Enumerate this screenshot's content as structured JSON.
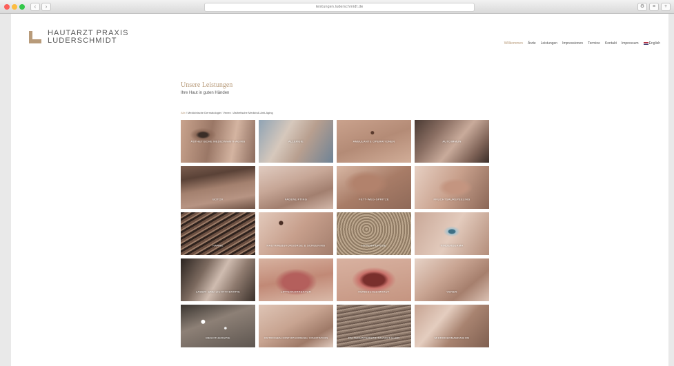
{
  "browser": {
    "address": "leistungen.luderschmidt.de"
  },
  "logo": {
    "line1": "HAUTARZT PRAXIS",
    "line2": "LUDERSCHMIDT"
  },
  "nav": {
    "items": [
      "Willkommen",
      "Ärzte",
      "Leistungen",
      "Impressionen",
      "Termine",
      "Kontakt",
      "Impressum",
      "English"
    ]
  },
  "section": {
    "title": "Unsere Leistungen",
    "subtitle": "Ihre Haut in guten Händen"
  },
  "filters": {
    "items": [
      "Alle",
      "Medizinische Dermatologie",
      "Venen",
      "Ästhetische Medizin& Anti-Aging"
    ],
    "separator": " / "
  },
  "tiles": [
    "ÄSTHETISCHE MEDIZIN/ANTI-AGING",
    "ALLERGIE",
    "AMBULANTE OPERATIONEN",
    "AUTOIMMUN",
    "BOTOX",
    "FADENLIFTING",
    "FETT-WEG-SPRITZE",
    "FRUCHTSÄUREPEELING",
    "HAARE",
    "HAUTKREBSVORSORGE & SCREENING",
    "HYPERHIDROSE",
    "KINDERDERMA",
    "LASER- UND LICHTTHERAPIE",
    "LIPPENKORREKTUR",
    "MUNDSCHLEIMHAUT",
    "VENEN",
    "MESOTHERAPIE",
    "OSTROGEN-IONTOPHORESE/ IONOTATION",
    "FALTENUNTERSPRITZUNG/FILLER",
    "MIKRODERMABRASION"
  ],
  "colors": {
    "accent": "#b89b7a",
    "text": "#555555"
  }
}
